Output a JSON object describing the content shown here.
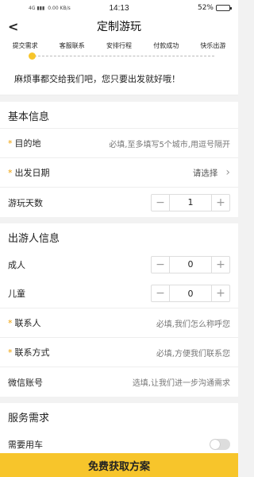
{
  "status_bar": {
    "signal_text": "4G ▮▮▮",
    "data_speed": "0.00 KB/s",
    "time": "14:13",
    "battery_text": "52%",
    "battery_level": 0.52
  },
  "nav": {
    "back_icon": "chevron-left-icon",
    "title": "定制游玩"
  },
  "steps": {
    "items": [
      "提交需求",
      "客服联系",
      "安排行程",
      "付款成功",
      "快乐出游"
    ],
    "active_index": 0,
    "accent": "#f7c52b"
  },
  "slogan": "麻烦事都交给我们吧，您只要出发就好哦！",
  "basic": {
    "title": "基本信息",
    "destination": {
      "label": "目的地",
      "placeholder": "必填,至多填写5个城市,用逗号隔开"
    },
    "date": {
      "label": "出发日期",
      "value": "请选择"
    },
    "days": {
      "label": "游玩天数",
      "value": "1",
      "minus": "−",
      "plus": "+"
    }
  },
  "travelers": {
    "title": "出游人信息",
    "adults": {
      "label": "成人",
      "value": "0",
      "minus": "−",
      "plus": "+"
    },
    "children": {
      "label": "儿童",
      "value": "0",
      "minus": "−",
      "plus": "+"
    },
    "contact": {
      "label": "联系人",
      "placeholder": "必填,我们怎么称呼您"
    },
    "phone": {
      "label": "联系方式",
      "placeholder": "必填,方便我们联系您"
    },
    "wechat": {
      "label": "微信账号",
      "placeholder": "选填,让我们进一步沟通需求"
    }
  },
  "service": {
    "title": "服务需求",
    "need_car": {
      "label": "需要用车",
      "on": false
    }
  },
  "cta": {
    "label": "免费获取方案"
  },
  "required_mark": "*"
}
